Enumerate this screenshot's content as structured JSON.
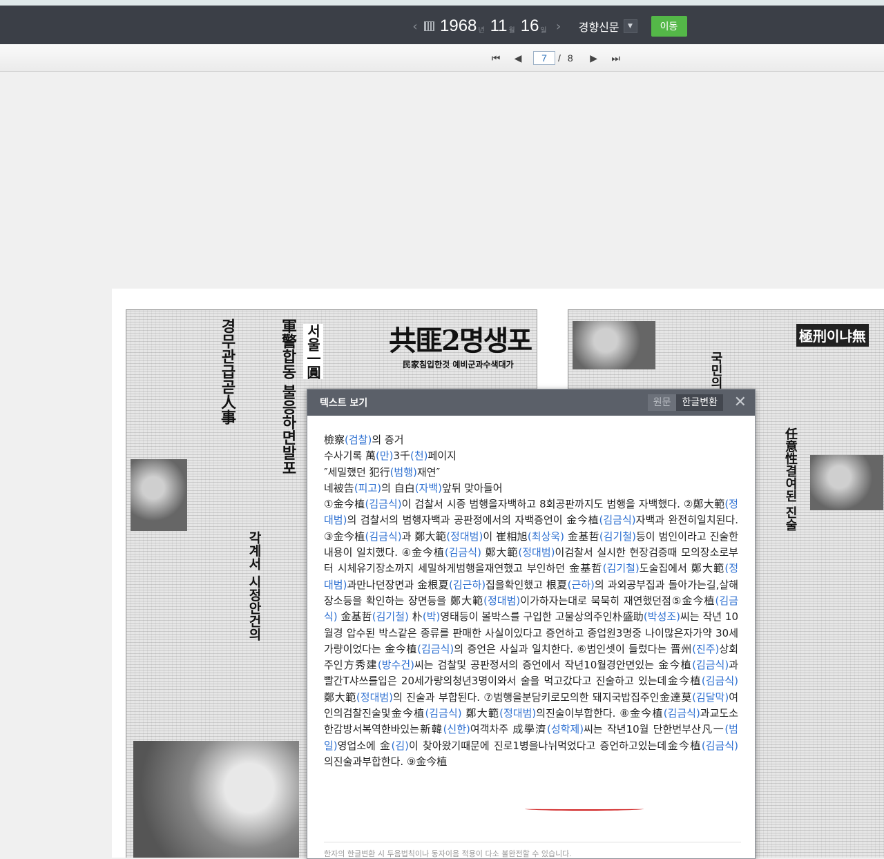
{
  "date_nav": {
    "year": "1968",
    "year_unit": "년",
    "month": "11",
    "month_unit": "월",
    "day": "16",
    "day_unit": "일",
    "newspaper": "경향신문",
    "go_label": "이동"
  },
  "pager": {
    "current": "7",
    "separator": "/",
    "total": "8"
  },
  "newspaper_page": {
    "headline_main": "共匪2명생포",
    "sub_headline": "民家침입한것 예비군과수색대가",
    "col1": "경무관급곧人事",
    "col2": "軍警합동 불응하면발포",
    "col3": "서울一圓",
    "col4": "각계서 시정안건의",
    "right1": "국민의",
    "right2": "極刑이냐無",
    "right3": "任意性결여된 진술"
  },
  "text_modal": {
    "title": "텍스트 보기",
    "tab_original": "원문",
    "tab_converted": "한글변환",
    "headlines": [
      [
        {
          "t": "檢察"
        },
        {
          "t": "(검찰)",
          "k": 1
        },
        {
          "t": "의 증거"
        }
      ],
      [
        {
          "t": "수사기록 萬"
        },
        {
          "t": "(만)",
          "k": 1
        },
        {
          "t": "3千"
        },
        {
          "t": "(천)",
          "k": 1
        },
        {
          "t": "페이지"
        }
      ],
      [
        {
          "t": "″세밀했던 犯行"
        },
        {
          "t": "(범행)",
          "k": 1
        },
        {
          "t": "재연″"
        }
      ],
      [
        {
          "t": "네被告"
        },
        {
          "t": "(피고)",
          "k": 1
        },
        {
          "t": "의 自白"
        },
        {
          "t": "(자백)",
          "k": 1
        },
        {
          "t": "앞뒤 맞아들어"
        }
      ]
    ],
    "paragraph": [
      {
        "t": "①金今植"
      },
      {
        "t": "(김금식)",
        "k": 1
      },
      {
        "t": "이 검찰서 시종 범행을자백하고 8회공판까지도 범행을 자백했다. ②鄭大範"
      },
      {
        "t": "(정대범)",
        "k": 1
      },
      {
        "t": "의 검찰서의 범행자백과 공판정에서의 자백증언이 金今植"
      },
      {
        "t": "(김금식)",
        "k": 1
      },
      {
        "t": "자백과 완전히일치된다.③金今植"
      },
      {
        "t": "(김금식)",
        "k": 1
      },
      {
        "t": "과 鄭大範"
      },
      {
        "t": "(정대범)",
        "k": 1
      },
      {
        "t": "이 崔相旭"
      },
      {
        "t": "(최상욱)",
        "k": 1
      },
      {
        "t": " 金基哲"
      },
      {
        "t": "(김기철)",
        "k": 1
      },
      {
        "t": "등이 범인이라고 진술한내용이 일치했다. ④金今植"
      },
      {
        "t": "(김금식)",
        "k": 1
      },
      {
        "t": " 鄭大範"
      },
      {
        "t": "(정대범)",
        "k": 1
      },
      {
        "t": "이검찰서 실시한 현장검증때 모의장소로부터 시체유기장소까지 세밀하게범행을재연했고 부인하던 金基哲"
      },
      {
        "t": "(김기철)",
        "k": 1
      },
      {
        "t": "도술집에서 鄭大範"
      },
      {
        "t": "(정대범)",
        "k": 1
      },
      {
        "t": "과만나던장면과 金根夏"
      },
      {
        "t": "(김근하)",
        "k": 1
      },
      {
        "t": "집을확인했고 根夏"
      },
      {
        "t": "(근하)",
        "k": 1
      },
      {
        "t": "의 과외공부집과 돌아가는길,살해장소등을 확인하는 장면등을 鄭大範"
      },
      {
        "t": "(정대범)",
        "k": 1
      },
      {
        "t": "이가하자는대로 묵묵히 재연했던점⑤金今植"
      },
      {
        "t": "(김금식)",
        "k": 1
      },
      {
        "t": " 金基哲"
      },
      {
        "t": "(김기철)",
        "k": 1
      },
      {
        "t": " 朴"
      },
      {
        "t": "(박)",
        "k": 1
      },
      {
        "t": "영태등이 볼박스를 구입한 고물상의주인朴盛助"
      },
      {
        "t": "(박성조)",
        "k": 1
      },
      {
        "t": "씨는 작년 10월경 압수된 박스같은 종류를 판매한 사실이있다고 증언하고 종업원3명중 나이많은자가약 30세가량이었다는 金今植"
      },
      {
        "t": "(김금식)",
        "k": 1
      },
      {
        "t": "의 증언은 사실과 일치한다. ⑥범인셋이 들렀다는 晋州"
      },
      {
        "t": "(진주)",
        "k": 1
      },
      {
        "t": "상회 주인方秀建"
      },
      {
        "t": "(방수건)",
        "k": 1
      },
      {
        "t": "씨는 검찰및 공판정서의 증언에서 작년10월경안면있는 金今植"
      },
      {
        "t": "(김금식)",
        "k": 1
      },
      {
        "t": "과 빨간T샤쓰를입은 20세가량의청년3명이와서 술을 먹고갔다고 진술하고 있는데金今植"
      },
      {
        "t": "(김금식)",
        "k": 1
      },
      {
        "t": " 鄭大範"
      },
      {
        "t": "(정대범)",
        "k": 1
      },
      {
        "t": "의 진술과 부합된다. ⑦범행을분담키로모의한 돼지국밥집주인金達莫"
      },
      {
        "t": "(김달막)",
        "k": 1
      },
      {
        "t": "여인의검찰진술및金今植"
      },
      {
        "t": "(김금식)",
        "k": 1
      },
      {
        "t": " 鄭大範"
      },
      {
        "t": "(정대범)",
        "k": 1
      },
      {
        "t": "의진술이부합한다. ⑧金今植"
      },
      {
        "t": "(김금식)",
        "k": 1
      },
      {
        "t": "과교도소 한감방서복역한바있는新韓"
      },
      {
        "t": "(신한)",
        "k": 1
      },
      {
        "t": "여객차주 成學濟"
      },
      {
        "t": "(성학제)",
        "k": 1
      },
      {
        "t": "씨는 작년10월 단한번부산凡一"
      },
      {
        "t": "(범일)",
        "k": 1
      },
      {
        "t": "영업소에 金"
      },
      {
        "t": "(김)",
        "k": 1
      },
      {
        "t": "이 찾아왔기때문에 진로1병을나뉘먹었다고 증언하고있는데金今植"
      },
      {
        "t": "(김금식)",
        "k": 1
      },
      {
        "t": "의진술과부합한다. ⑨金今植"
      }
    ],
    "footer": "한자의 한글변환 시 두음법칙이나 동자이음 적용이 다소 불완전할 수 있습니다."
  }
}
